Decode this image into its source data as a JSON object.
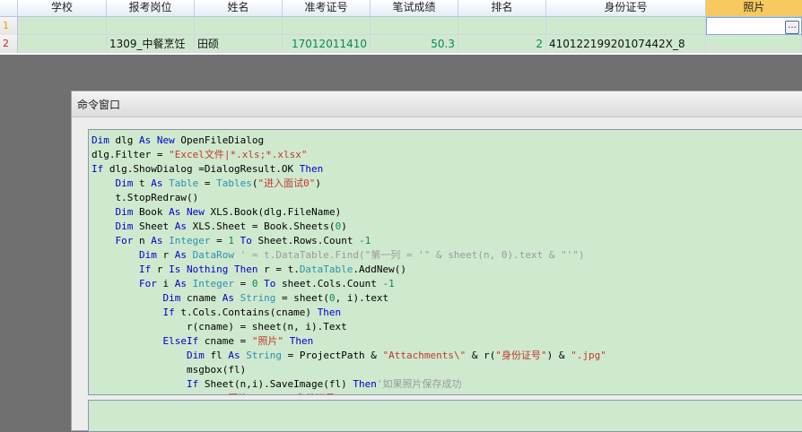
{
  "grid": {
    "columns": [
      "学校",
      "报考岗位",
      "姓名",
      "准考证号",
      "笔试成绩",
      "排名",
      "身份证号",
      "照片"
    ],
    "rows": [
      {
        "num": "1",
        "cells": [
          "",
          "",
          "",
          "",
          "",
          "",
          "",
          ""
        ]
      },
      {
        "num": "2",
        "cells": [
          "",
          "1309_中餐烹饪",
          "田硕",
          "17012011410",
          "50.3",
          "2",
          "41012219920107442X_8",
          ""
        ]
      }
    ],
    "ellipsis": "…"
  },
  "window": {
    "title": "命令窗口",
    "code_lines": [
      [
        [
          "kw",
          "Dim"
        ],
        [
          "t",
          " dlg "
        ],
        [
          "kw",
          "As New"
        ],
        [
          "t",
          " OpenFileDialog"
        ]
      ],
      [
        [
          "t",
          "dlg.Filter = "
        ],
        [
          "str",
          "\"Excel文件|*.xls;*.xlsx\""
        ]
      ],
      [
        [
          "kw",
          "If"
        ],
        [
          "t",
          " dlg.ShowDialog =DialogResult.OK "
        ],
        [
          "kw",
          "Then"
        ]
      ],
      [
        [
          "t",
          "    "
        ],
        [
          "kw",
          "Dim"
        ],
        [
          "t",
          " t "
        ],
        [
          "kw",
          "As"
        ],
        [
          "t",
          " "
        ],
        [
          "ty",
          "Table"
        ],
        [
          "t",
          " = "
        ],
        [
          "ty",
          "Tables"
        ],
        [
          "t",
          "("
        ],
        [
          "str",
          "\"进入面试0\""
        ],
        [
          "t",
          ")"
        ]
      ],
      [
        [
          "t",
          "    t.StopRedraw()"
        ]
      ],
      [
        [
          "t",
          "    "
        ],
        [
          "kw",
          "Dim"
        ],
        [
          "t",
          " Book "
        ],
        [
          "kw",
          "As New"
        ],
        [
          "t",
          " XLS.Book(dlg.FileName)"
        ]
      ],
      [
        [
          "t",
          "    "
        ],
        [
          "kw",
          "Dim"
        ],
        [
          "t",
          " Sheet "
        ],
        [
          "kw",
          "As"
        ],
        [
          "t",
          " XLS.Sheet = Book.Sheets("
        ],
        [
          "num",
          "0"
        ],
        [
          "t",
          ")"
        ]
      ],
      [
        [
          "t",
          "    "
        ],
        [
          "kw",
          "For"
        ],
        [
          "t",
          " n "
        ],
        [
          "kw",
          "As"
        ],
        [
          "t",
          " "
        ],
        [
          "ty",
          "Integer"
        ],
        [
          "t",
          " = "
        ],
        [
          "num",
          "1"
        ],
        [
          "t",
          " "
        ],
        [
          "kw",
          "To"
        ],
        [
          "t",
          " Sheet.Rows.Count "
        ],
        [
          "num",
          "-1"
        ]
      ],
      [
        [
          "t",
          "        "
        ],
        [
          "kw",
          "Dim"
        ],
        [
          "t",
          " r "
        ],
        [
          "kw",
          "As"
        ],
        [
          "t",
          " "
        ],
        [
          "ty",
          "DataRow"
        ],
        [
          "t",
          " "
        ],
        [
          "cm",
          "' = t.DataTable.Find(\"第一列 = '\" & sheet(n, 0).text & \"'\")"
        ]
      ],
      [
        [
          "t",
          "        "
        ],
        [
          "kw",
          "If"
        ],
        [
          "t",
          " r "
        ],
        [
          "kw",
          "Is Nothing Then"
        ],
        [
          "t",
          " r = t."
        ],
        [
          "ty",
          "DataTable"
        ],
        [
          "t",
          ".AddNew()"
        ]
      ],
      [
        [
          "t",
          "        "
        ],
        [
          "kw",
          "For"
        ],
        [
          "t",
          " i "
        ],
        [
          "kw",
          "As"
        ],
        [
          "t",
          " "
        ],
        [
          "ty",
          "Integer"
        ],
        [
          "t",
          " = "
        ],
        [
          "num",
          "0"
        ],
        [
          "t",
          " "
        ],
        [
          "kw",
          "To"
        ],
        [
          "t",
          " sheet.Cols.Count "
        ],
        [
          "num",
          "-1"
        ]
      ],
      [
        [
          "t",
          "            "
        ],
        [
          "kw",
          "Dim"
        ],
        [
          "t",
          " cname "
        ],
        [
          "kw",
          "As"
        ],
        [
          "t",
          " "
        ],
        [
          "ty",
          "String"
        ],
        [
          "t",
          " = sheet("
        ],
        [
          "num",
          "0"
        ],
        [
          "t",
          ", i).text"
        ]
      ],
      [
        [
          "t",
          "            "
        ],
        [
          "kw",
          "If"
        ],
        [
          "t",
          " t.Cols.Contains(cname) "
        ],
        [
          "kw",
          "Then"
        ]
      ],
      [
        [
          "t",
          "                r(cname) = sheet(n, i).Text"
        ]
      ],
      [
        [
          "t",
          "            "
        ],
        [
          "kw",
          "ElseIf"
        ],
        [
          "t",
          " cname = "
        ],
        [
          "str",
          "\"照片\""
        ],
        [
          "t",
          " "
        ],
        [
          "kw",
          "Then"
        ]
      ],
      [
        [
          "t",
          "                "
        ],
        [
          "kw",
          "Dim"
        ],
        [
          "t",
          " fl "
        ],
        [
          "kw",
          "As"
        ],
        [
          "t",
          " "
        ],
        [
          "ty",
          "String"
        ],
        [
          "t",
          " = ProjectPath & "
        ],
        [
          "str",
          "\"Attachments\\\""
        ],
        [
          "t",
          " & r("
        ],
        [
          "str",
          "\"身份证号\""
        ],
        [
          "t",
          ") & "
        ],
        [
          "str",
          "\".jpg\""
        ]
      ],
      [
        [
          "t",
          "                msgbox(fl)"
        ]
      ],
      [
        [
          "t",
          "                "
        ],
        [
          "kw",
          "If"
        ],
        [
          "t",
          " Sheet(n,i).SaveImage(fl) "
        ],
        [
          "kw",
          "Then"
        ],
        [
          "cm",
          "'如果照片保存成功"
        ]
      ],
      [
        [
          "t",
          "                    r("
        ],
        [
          "str",
          "\"照片\""
        ],
        [
          "t",
          ") = r("
        ],
        [
          "str",
          "\"身份证号\""
        ],
        [
          "t",
          ") & "
        ],
        [
          "str",
          "\".jpg\""
        ]
      ]
    ]
  }
}
